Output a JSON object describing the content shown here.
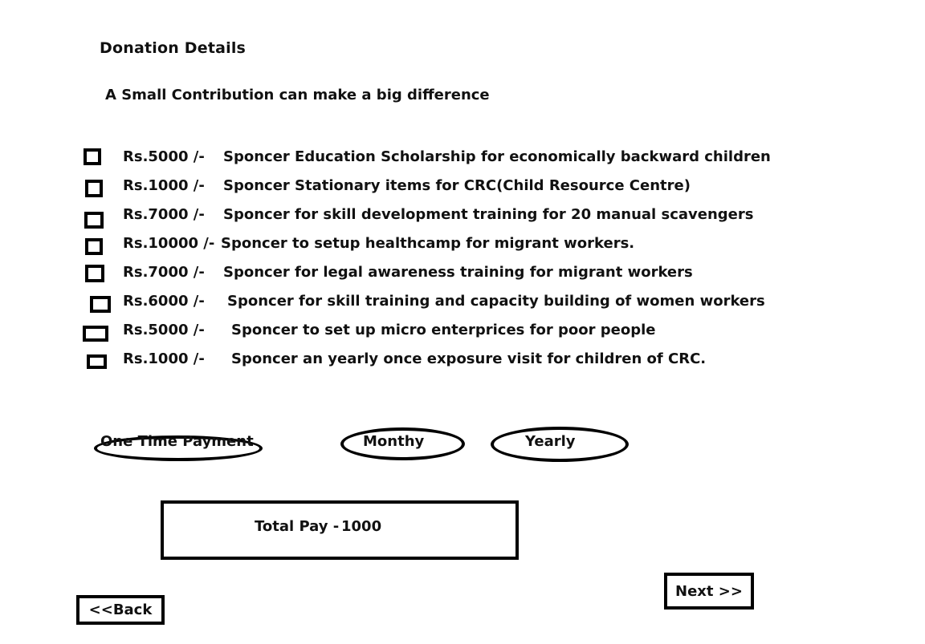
{
  "page": {
    "title": "Donation Details",
    "subtitle": "A Small Contribution can make a big difference"
  },
  "donations": [
    {
      "amount": "Rs.5000 /-",
      "description": "Sponcer Education Scholarship for economically backward children",
      "checked": false
    },
    {
      "amount": "Rs.1000 /-",
      "description": "Sponcer Stationary items for CRC(Child Resource Centre)",
      "checked": false
    },
    {
      "amount": "Rs.7000 /-",
      "description": "Sponcer for skill development training for 20 manual scavengers",
      "checked": false
    },
    {
      "amount": "Rs.10000 /-",
      "description": "Sponcer to setup healthcamp for migrant workers.",
      "checked": false
    },
    {
      "amount": "Rs.7000 /-",
      "description": "Sponcer for legal awareness training for migrant workers",
      "checked": false
    },
    {
      "amount": "Rs.6000 /-",
      "description": "Sponcer for skill training and capacity building of women workers",
      "checked": false
    },
    {
      "amount": "Rs.5000 /-",
      "description": "Sponcer to set up micro enterprices for poor people",
      "checked": false
    },
    {
      "amount": "Rs.1000 /-",
      "description": "Sponcer an yearly once exposure visit for children of CRC.",
      "checked": false
    }
  ],
  "payment_options": [
    {
      "label": "One Time Payment"
    },
    {
      "label": "Monthy"
    },
    {
      "label": "Yearly"
    }
  ],
  "total": {
    "label": "Total Pay -",
    "value": "1000"
  },
  "nav": {
    "next_label": "Next >>",
    "back_label": "<<Back"
  }
}
